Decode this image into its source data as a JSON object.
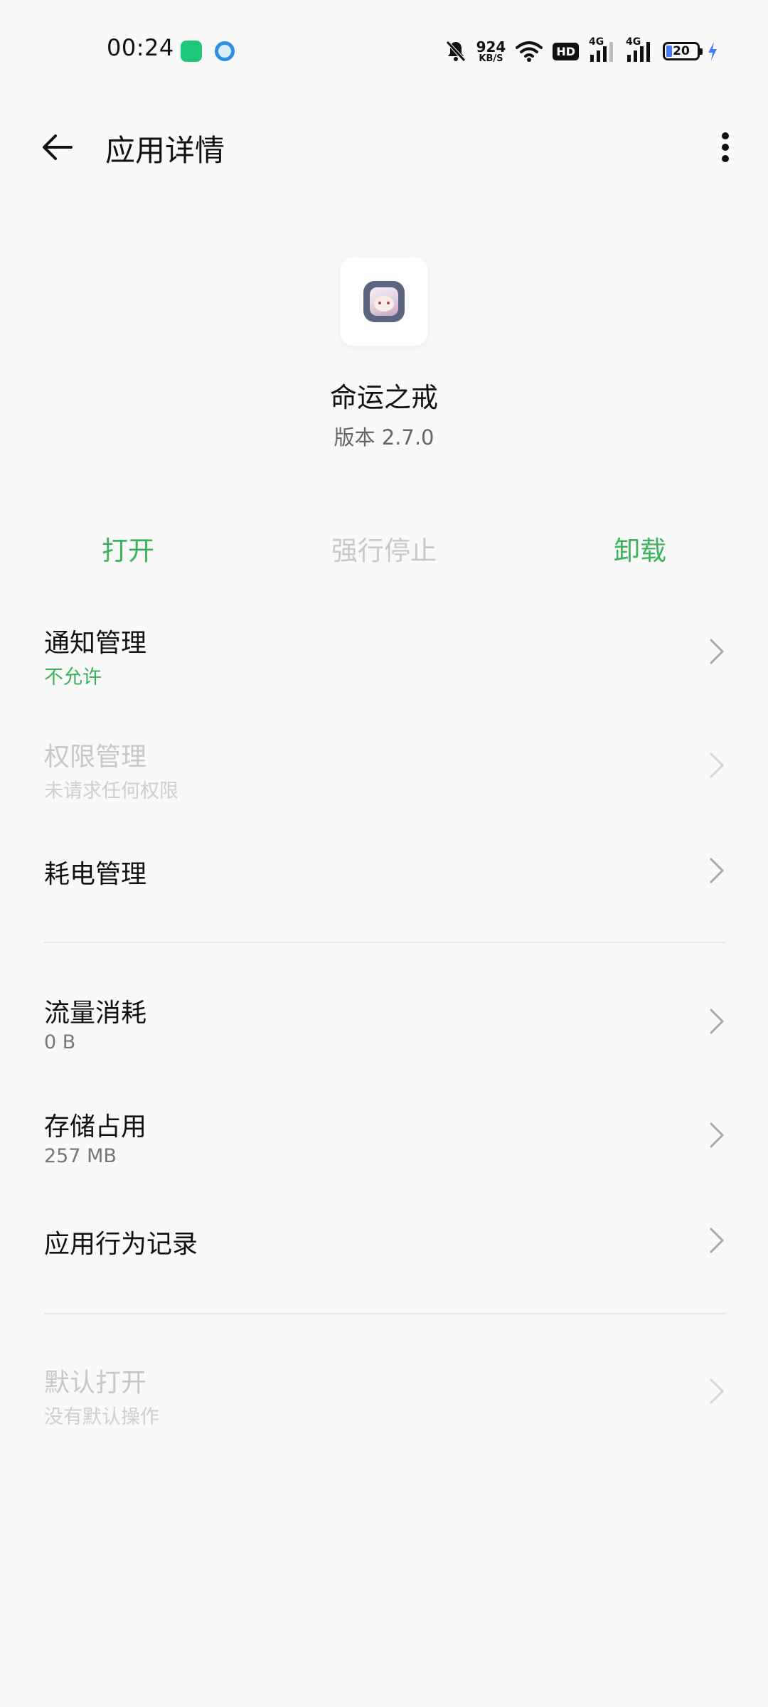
{
  "status_bar": {
    "time": "00:24",
    "net_speed_value": "924",
    "net_speed_unit": "KB/S",
    "hd_label": "HD",
    "sim1_label": "4G",
    "sim2_label": "4G",
    "battery_level": "20",
    "icons": [
      "app-notification-icon",
      "browser-notification-icon",
      "mute-bell-icon",
      "wifi-icon",
      "signal-icon",
      "battery-icon",
      "charging-icon"
    ]
  },
  "header": {
    "title": "应用详情"
  },
  "app": {
    "name": "命运之戒",
    "version": "版本 2.7.0"
  },
  "actions": {
    "open": "打开",
    "force_stop": "强行停止",
    "uninstall": "卸载"
  },
  "rows": {
    "notifications": {
      "title": "通知管理",
      "sub": "不允许"
    },
    "permissions": {
      "title": "权限管理",
      "sub": "未请求任何权限"
    },
    "battery": {
      "title": "耗电管理"
    },
    "data_usage": {
      "title": "流量消耗",
      "sub": "0 B"
    },
    "storage": {
      "title": "存储占用",
      "sub": "257 MB"
    },
    "behavior": {
      "title": "应用行为记录"
    },
    "default_open": {
      "title": "默认打开",
      "sub": "没有默认操作"
    }
  },
  "colors": {
    "accent": "#3bb35a",
    "disabled": "#c8c8c8",
    "background": "#f9f9f9"
  }
}
